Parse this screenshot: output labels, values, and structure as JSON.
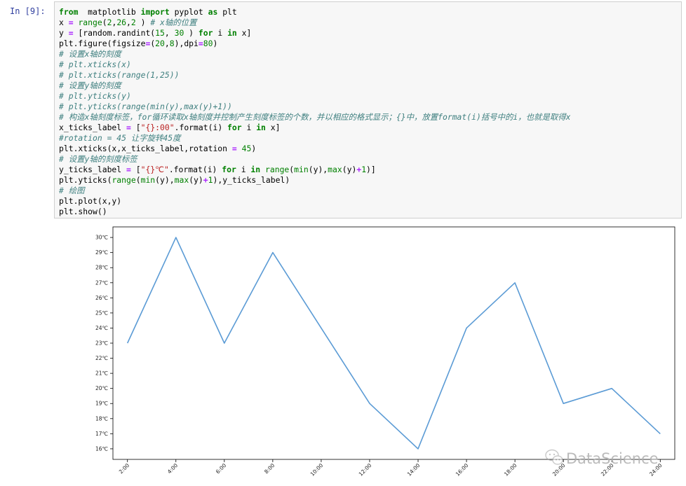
{
  "cell": {
    "prompt": "In  [9]:",
    "lines": [
      [
        [
          "kw",
          "from"
        ],
        [
          "",
          "  matplotlib "
        ],
        [
          "kw",
          "import"
        ],
        [
          "",
          " pyplot "
        ],
        [
          "kw",
          "as"
        ],
        [
          "",
          " plt"
        ]
      ],
      [
        [
          "",
          "x "
        ],
        [
          "op",
          "="
        ],
        [
          "",
          " "
        ],
        [
          "bi",
          "range"
        ],
        [
          "",
          "("
        ],
        [
          "num",
          "2"
        ],
        [
          "",
          ","
        ],
        [
          "num",
          "26"
        ],
        [
          "",
          ","
        ],
        [
          "num",
          "2"
        ],
        [
          "",
          " ) "
        ],
        [
          "cm",
          "# x轴的位置"
        ]
      ],
      [
        [
          "",
          "y "
        ],
        [
          "op",
          "="
        ],
        [
          "",
          " [random.randint("
        ],
        [
          "num",
          "15"
        ],
        [
          "",
          ", "
        ],
        [
          "num",
          "30"
        ],
        [
          "",
          " ) "
        ],
        [
          "kw",
          "for"
        ],
        [
          "",
          " i "
        ],
        [
          "kw",
          "in"
        ],
        [
          "",
          " x]"
        ]
      ],
      [
        [
          "",
          "plt.figure(figsize"
        ],
        [
          "op",
          "="
        ],
        [
          "",
          "("
        ],
        [
          "num",
          "20"
        ],
        [
          "",
          ","
        ],
        [
          "num",
          "8"
        ],
        [
          "",
          "),dpi"
        ],
        [
          "op",
          "="
        ],
        [
          "num",
          "80"
        ],
        [
          "",
          ")"
        ]
      ],
      [
        [
          "cm",
          "# 设置x轴的刻度"
        ]
      ],
      [
        [
          "cm",
          "# plt.xticks(x)"
        ]
      ],
      [
        [
          "cm",
          "# plt.xticks(range(1,25))"
        ]
      ],
      [
        [
          "cm",
          "# 设置y轴的刻度"
        ]
      ],
      [
        [
          "cm",
          "# plt.yticks(y)"
        ]
      ],
      [
        [
          "cm",
          "# plt.yticks(range(min(y),max(y)+1))"
        ]
      ],
      [
        [
          "cm",
          "# 构造x轴刻度标签，for循环读取x轴刻度并控制产生刻度标签的个数，并以相应的格式显示；{}中，放置format(i)括号中的i，也就是取得x"
        ]
      ],
      [
        [
          "",
          "x_ticks_label "
        ],
        [
          "op",
          "="
        ],
        [
          "",
          " ["
        ],
        [
          "str",
          "\"{}:00\""
        ],
        [
          "",
          ".format(i) "
        ],
        [
          "kw",
          "for"
        ],
        [
          "",
          " i "
        ],
        [
          "kw",
          "in"
        ],
        [
          "",
          " x]"
        ]
      ],
      [
        [
          "cm",
          "#rotation = 45 让字旋转45度"
        ]
      ],
      [
        [
          "",
          "plt.xticks(x,x_ticks_label,rotation "
        ],
        [
          "op",
          "="
        ],
        [
          "",
          " "
        ],
        [
          "num",
          "45"
        ],
        [
          "",
          ")"
        ]
      ],
      [
        [
          "cm",
          "# 设置y轴的刻度标签"
        ]
      ],
      [
        [
          "",
          "y_ticks_label "
        ],
        [
          "op",
          "="
        ],
        [
          "",
          " ["
        ],
        [
          "str",
          "\"{}℃\""
        ],
        [
          "",
          ".format(i) "
        ],
        [
          "kw",
          "for"
        ],
        [
          "",
          " i "
        ],
        [
          "kw",
          "in"
        ],
        [
          "",
          " "
        ],
        [
          "bi",
          "range"
        ],
        [
          "",
          "("
        ],
        [
          "bi",
          "min"
        ],
        [
          "",
          "(y),"
        ],
        [
          "bi",
          "max"
        ],
        [
          "",
          "(y)"
        ],
        [
          "op",
          "+"
        ],
        [
          "num",
          "1"
        ],
        [
          "",
          ")]"
        ]
      ],
      [
        [
          "",
          "plt.yticks("
        ],
        [
          "bi",
          "range"
        ],
        [
          "",
          "("
        ],
        [
          "bi",
          "min"
        ],
        [
          "",
          "(y),"
        ],
        [
          "bi",
          "max"
        ],
        [
          "",
          "(y)"
        ],
        [
          "op",
          "+"
        ],
        [
          "num",
          "1"
        ],
        [
          "",
          "),y_ticks_label)"
        ]
      ],
      [
        [
          "cm",
          "# 绘图"
        ]
      ],
      [
        [
          "",
          "plt.plot(x,y)"
        ]
      ],
      [
        [
          "",
          "plt.show()"
        ]
      ]
    ]
  },
  "chart_data": {
    "type": "line",
    "x": [
      2,
      4,
      6,
      8,
      10,
      12,
      14,
      16,
      18,
      20,
      22,
      24
    ],
    "y": [
      23,
      30,
      23,
      29,
      24,
      19,
      16,
      24,
      27,
      19,
      20,
      17
    ],
    "xticks": [
      2,
      4,
      6,
      8,
      10,
      12,
      14,
      16,
      18,
      20,
      22,
      24
    ],
    "xtick_labels": [
      "2:00",
      "4:00",
      "6:00",
      "8:00",
      "10:00",
      "12:00",
      "14:00",
      "16:00",
      "18:00",
      "20:00",
      "22:00",
      "24:00"
    ],
    "yticks": [
      16,
      17,
      18,
      19,
      20,
      21,
      22,
      23,
      24,
      25,
      26,
      27,
      28,
      29,
      30
    ],
    "ytick_labels": [
      "16℃",
      "17℃",
      "18℃",
      "19℃",
      "20℃",
      "21℃",
      "22℃",
      "23℃",
      "24℃",
      "25℃",
      "26℃",
      "27℃",
      "28℃",
      "29℃",
      "30℃"
    ],
    "xlim": [
      1.4,
      24.6
    ],
    "ylim": [
      15.3,
      30.7
    ],
    "xtick_rotation": 45,
    "grid": false,
    "line_color": "#5b9bd5"
  },
  "watermark": {
    "text": "DataScience",
    "icon": "wechat-icon"
  },
  "colors": {
    "keyword": "#008000",
    "operator": "#aa22ff",
    "string": "#ba2121",
    "comment": "#408080",
    "prompt": "#303f9f"
  }
}
